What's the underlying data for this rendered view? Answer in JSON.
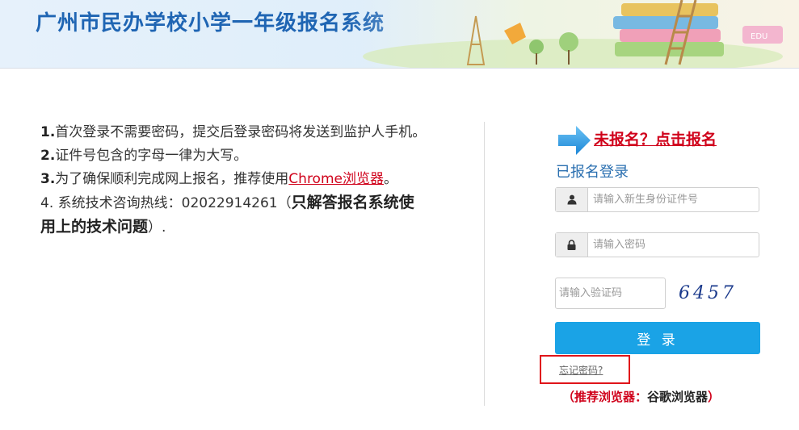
{
  "header": {
    "title": "广州市民办学校小学一年级报名系统"
  },
  "notice": {
    "line1_num": "1.",
    "line1_text": "首次登录不需要密码，提交后登录密码将发送到监护人手机。",
    "line2_num": "2.",
    "line2_text": "证件号包含的字母一律为大写。",
    "line3_num": "3.",
    "line3_text": "为了确保顺利完成网上报名，推荐使用",
    "line3_link": "Chrome浏览器",
    "line3_end": "。",
    "line4_prefix": "4. 系统技术咨询热线：02022914261（",
    "line4_bold": "只解答报名系统使用上的技术问题",
    "line4_suffix": "）."
  },
  "register": {
    "link_label": "未报名？点击报名"
  },
  "login": {
    "title": "已报名登录",
    "id_placeholder": "请输入新生身份证件号",
    "password_placeholder": "请输入密码",
    "captcha_placeholder": "请输入验证码",
    "captcha_code": "6457",
    "submit_label": "登 录",
    "forgot_label": "忘记密码?",
    "recommend_prefix": "（推荐浏览器：",
    "recommend_browser": "谷歌浏览器",
    "recommend_suffix": "）"
  },
  "colors": {
    "brand_blue": "#1f65b3",
    "button_blue": "#1aa3e6",
    "alert_red": "#d0021b"
  },
  "icons": {
    "id_field": "user-icon",
    "password_field": "lock-icon",
    "register_arrow": "arrow-right-icon"
  }
}
